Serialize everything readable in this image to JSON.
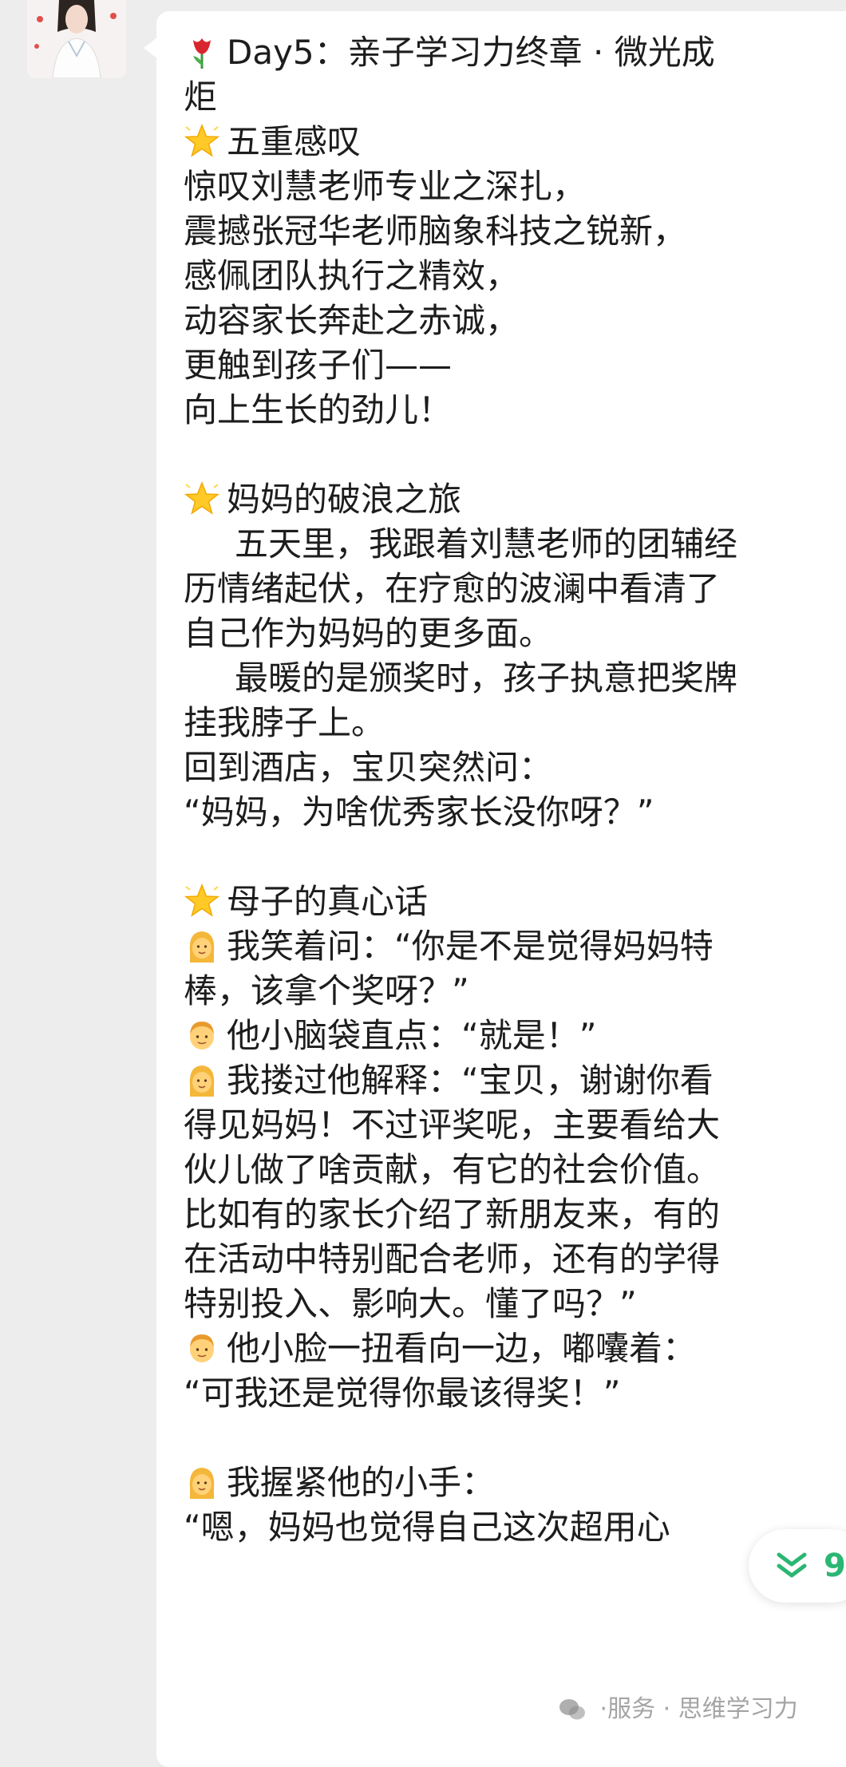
{
  "message": {
    "lines": [
      {
        "emoji": "tulip-emoji",
        "text": "Day5：亲子学习力终章 · 微光成"
      },
      {
        "text": "炬"
      },
      {
        "emoji": "glowing-star-emoji",
        "text": "五重感叹"
      },
      {
        "text": "惊叹刘慧老师专业之深扎，"
      },
      {
        "text": "震撼张冠华老师脑象科技之锐新，"
      },
      {
        "text": "感佩团队执行之精效，"
      },
      {
        "text": "动容家长奔赴之赤诚，"
      },
      {
        "text": "更触到孩子们——"
      },
      {
        "text": "向上生长的劲儿！"
      },
      {
        "blank": true
      },
      {
        "emoji": "glowing-star-emoji",
        "text": "妈妈的破浪之旅"
      },
      {
        "indent": true,
        "text": "五天里，我跟着刘慧老师的团辅经"
      },
      {
        "text": "历情绪起伏，在疗愈的波澜中看清了"
      },
      {
        "text": "自己作为妈妈的更多面。"
      },
      {
        "indent": true,
        "text": "最暖的是颁奖时，孩子执意把奖牌"
      },
      {
        "text": "挂我脖子上。"
      },
      {
        "text": "回到酒店，宝贝突然问："
      },
      {
        "text": "“妈妈，为啥优秀家长没你呀？”"
      },
      {
        "blank": true
      },
      {
        "emoji": "glowing-star-emoji",
        "text": "母子的真心话"
      },
      {
        "emoji": "woman-emoji",
        "text": "我笑着问：“你是不是觉得妈妈特"
      },
      {
        "text": "棒，该拿个奖呀？”"
      },
      {
        "emoji": "boy-emoji",
        "text": "他小脑袋直点：“就是！”"
      },
      {
        "emoji": "woman-emoji",
        "text": "我搂过他解释：“宝贝，谢谢你看"
      },
      {
        "text": "得见妈妈！不过评奖呢，主要看给大"
      },
      {
        "text": "伙儿做了啥贡献，有它的社会价值。"
      },
      {
        "text": "比如有的家长介绍了新朋友来，有的"
      },
      {
        "text": "在活动中特别配合老师，还有的学得"
      },
      {
        "text": "特别投入、影响大。懂了吗？”"
      },
      {
        "emoji": "boy-emoji",
        "text": "他小脸一扭看向一边，嘟囔着："
      },
      {
        "text": "“可我还是觉得你最该得奖！”"
      },
      {
        "blank": true
      },
      {
        "emoji": "woman-emoji",
        "text": "我握紧他的小手："
      },
      {
        "text": "“嗯，妈妈也觉得自己这次超用心"
      }
    ]
  },
  "badge": {
    "icon": "double-chevron-down-icon",
    "count": "9"
  },
  "watermark": {
    "icon": "wechat-logo-icon",
    "text": "·服务 · 思维学习力"
  },
  "colors": {
    "background": "#ededed",
    "bubble": "#ffffff",
    "text": "#1d1d1d",
    "accent": "#2bb673"
  }
}
